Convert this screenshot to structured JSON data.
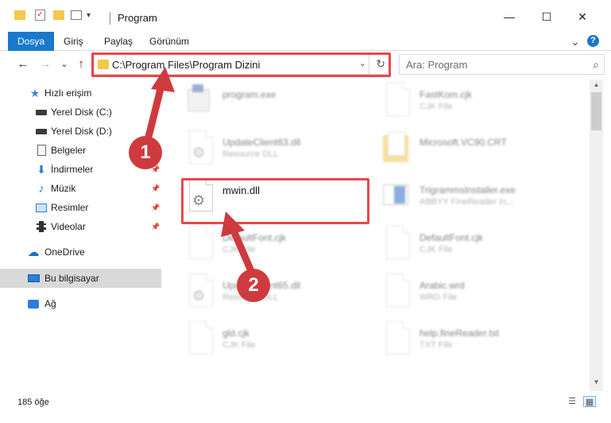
{
  "window": {
    "title": "Program",
    "minimize_glyph": "—",
    "maximize_glyph": "☐",
    "close_glyph": "✕"
  },
  "ribbon": {
    "tabs": [
      "Dosya",
      "Giriş",
      "Paylaş",
      "Görünüm"
    ],
    "expand_glyph": "⌄",
    "help_glyph": "?"
  },
  "nav": {
    "back_glyph": "←",
    "forward_glyph": "→",
    "recent_glyph": "⌄",
    "up_glyph": "↑",
    "address": "C:\\Program Files\\Program Dizini",
    "address_dropdown_glyph": "⌄",
    "refresh_glyph": "↻",
    "search_placeholder": "Ara: Program",
    "search_glyph": "⌕"
  },
  "sidebar": {
    "items": [
      {
        "label": "Hızlı erişim",
        "icon": "star-icon",
        "glyph": "★",
        "color": "#3a86d4"
      },
      {
        "label": "Yerel Disk (C:)",
        "icon": "drive-icon",
        "glyph": "▬",
        "color": "#3b3b3b"
      },
      {
        "label": "Yerel Disk (D:)",
        "icon": "drive-icon",
        "glyph": "▬",
        "color": "#3b3b3b"
      },
      {
        "label": "Belgeler",
        "icon": "documents-icon",
        "glyph": "▤",
        "color": "#555555"
      },
      {
        "label": "İndirmeler",
        "icon": "download-icon",
        "glyph": "⬇",
        "color": "#2b7fd6"
      },
      {
        "label": "Müzik",
        "icon": "music-icon",
        "glyph": "♪",
        "color": "#2b7fd6"
      },
      {
        "label": "Resimler",
        "icon": "pictures-icon",
        "glyph": "▣",
        "color": "#2b7fd6"
      },
      {
        "label": "Videolar",
        "icon": "videos-icon",
        "glyph": "▦",
        "color": "#333333"
      },
      {
        "label": "OneDrive",
        "icon": "cloud-icon",
        "glyph": "☁",
        "color": "#1f6fc5"
      },
      {
        "label": "Bu bilgisayar",
        "icon": "computer-icon",
        "glyph": "▭",
        "color": "#2b7fd6"
      },
      {
        "label": "Ağ",
        "icon": "network-icon",
        "glyph": "⛁",
        "color": "#2b7fd6"
      }
    ]
  },
  "files": [
    {
      "name": "program.exe",
      "type": ""
    },
    {
      "name": "FastKom.cjk",
      "type": "CJK File"
    },
    {
      "name": "UpdateClient63.dll",
      "type": "Resource DLL"
    },
    {
      "name": "Microsoft.VC90.CRT",
      "type": ""
    },
    {
      "name": "mwin.dll",
      "type": ""
    },
    {
      "name": "TrigrammsInstaller.exe",
      "type": "ABBYY FineReader In..."
    },
    {
      "name": "DefaultFont.cjk",
      "type": "CJK File"
    },
    {
      "name": "DefaultFont.cjk",
      "type": "CJK File"
    },
    {
      "name": "UpdateClient65.dll",
      "type": "Resource DLL"
    },
    {
      "name": "Arabic.wrd",
      "type": "WRD File"
    },
    {
      "name": "gld.cjk",
      "type": "CJK File"
    },
    {
      "name": "help.fineReader.txt",
      "type": "TXT File"
    }
  ],
  "status": {
    "item_count": "185 öğe"
  },
  "annotations": {
    "step1": "1",
    "step2": "2",
    "highlight_color": "#e8484a"
  }
}
